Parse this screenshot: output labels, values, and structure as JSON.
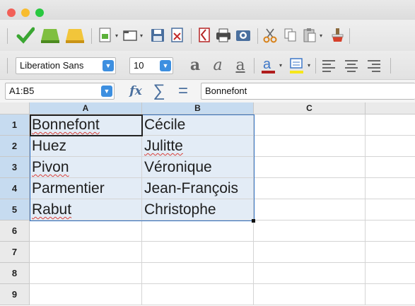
{
  "window": {
    "close_color": "#f25f57",
    "minimize_color": "#f8bc2f",
    "zoom_color": "#29c840"
  },
  "toolbar1": {
    "icons": [
      "apply-icon",
      "green-bar-icon",
      "yellow-bar-icon",
      "insert-sheet-icon",
      "open-icon",
      "save-icon",
      "export-icon",
      "pdf-icon",
      "print-icon",
      "print-preview-icon",
      "cut-icon",
      "copy-icon",
      "paste-icon",
      "clone-formatting-icon"
    ]
  },
  "toolbar2": {
    "font_name": "Liberation Sans",
    "font_size": "10",
    "font_color": "#b01c1c",
    "highlight_color": "#f6e71b"
  },
  "formula_bar": {
    "name_box": "A1:B5",
    "content": "Bonnefont"
  },
  "sheet": {
    "columns": [
      "A",
      "B",
      "C"
    ],
    "rows": [
      "1",
      "2",
      "3",
      "4",
      "5",
      "6",
      "7",
      "8",
      "9"
    ],
    "cells": [
      [
        "Bonnefont",
        "Cécile"
      ],
      [
        "Huez",
        "Julitte"
      ],
      [
        "Pivon",
        "Véronique"
      ],
      [
        "Parmentier",
        "Jean-François"
      ],
      [
        "Rabut",
        "Christophe"
      ]
    ]
  }
}
